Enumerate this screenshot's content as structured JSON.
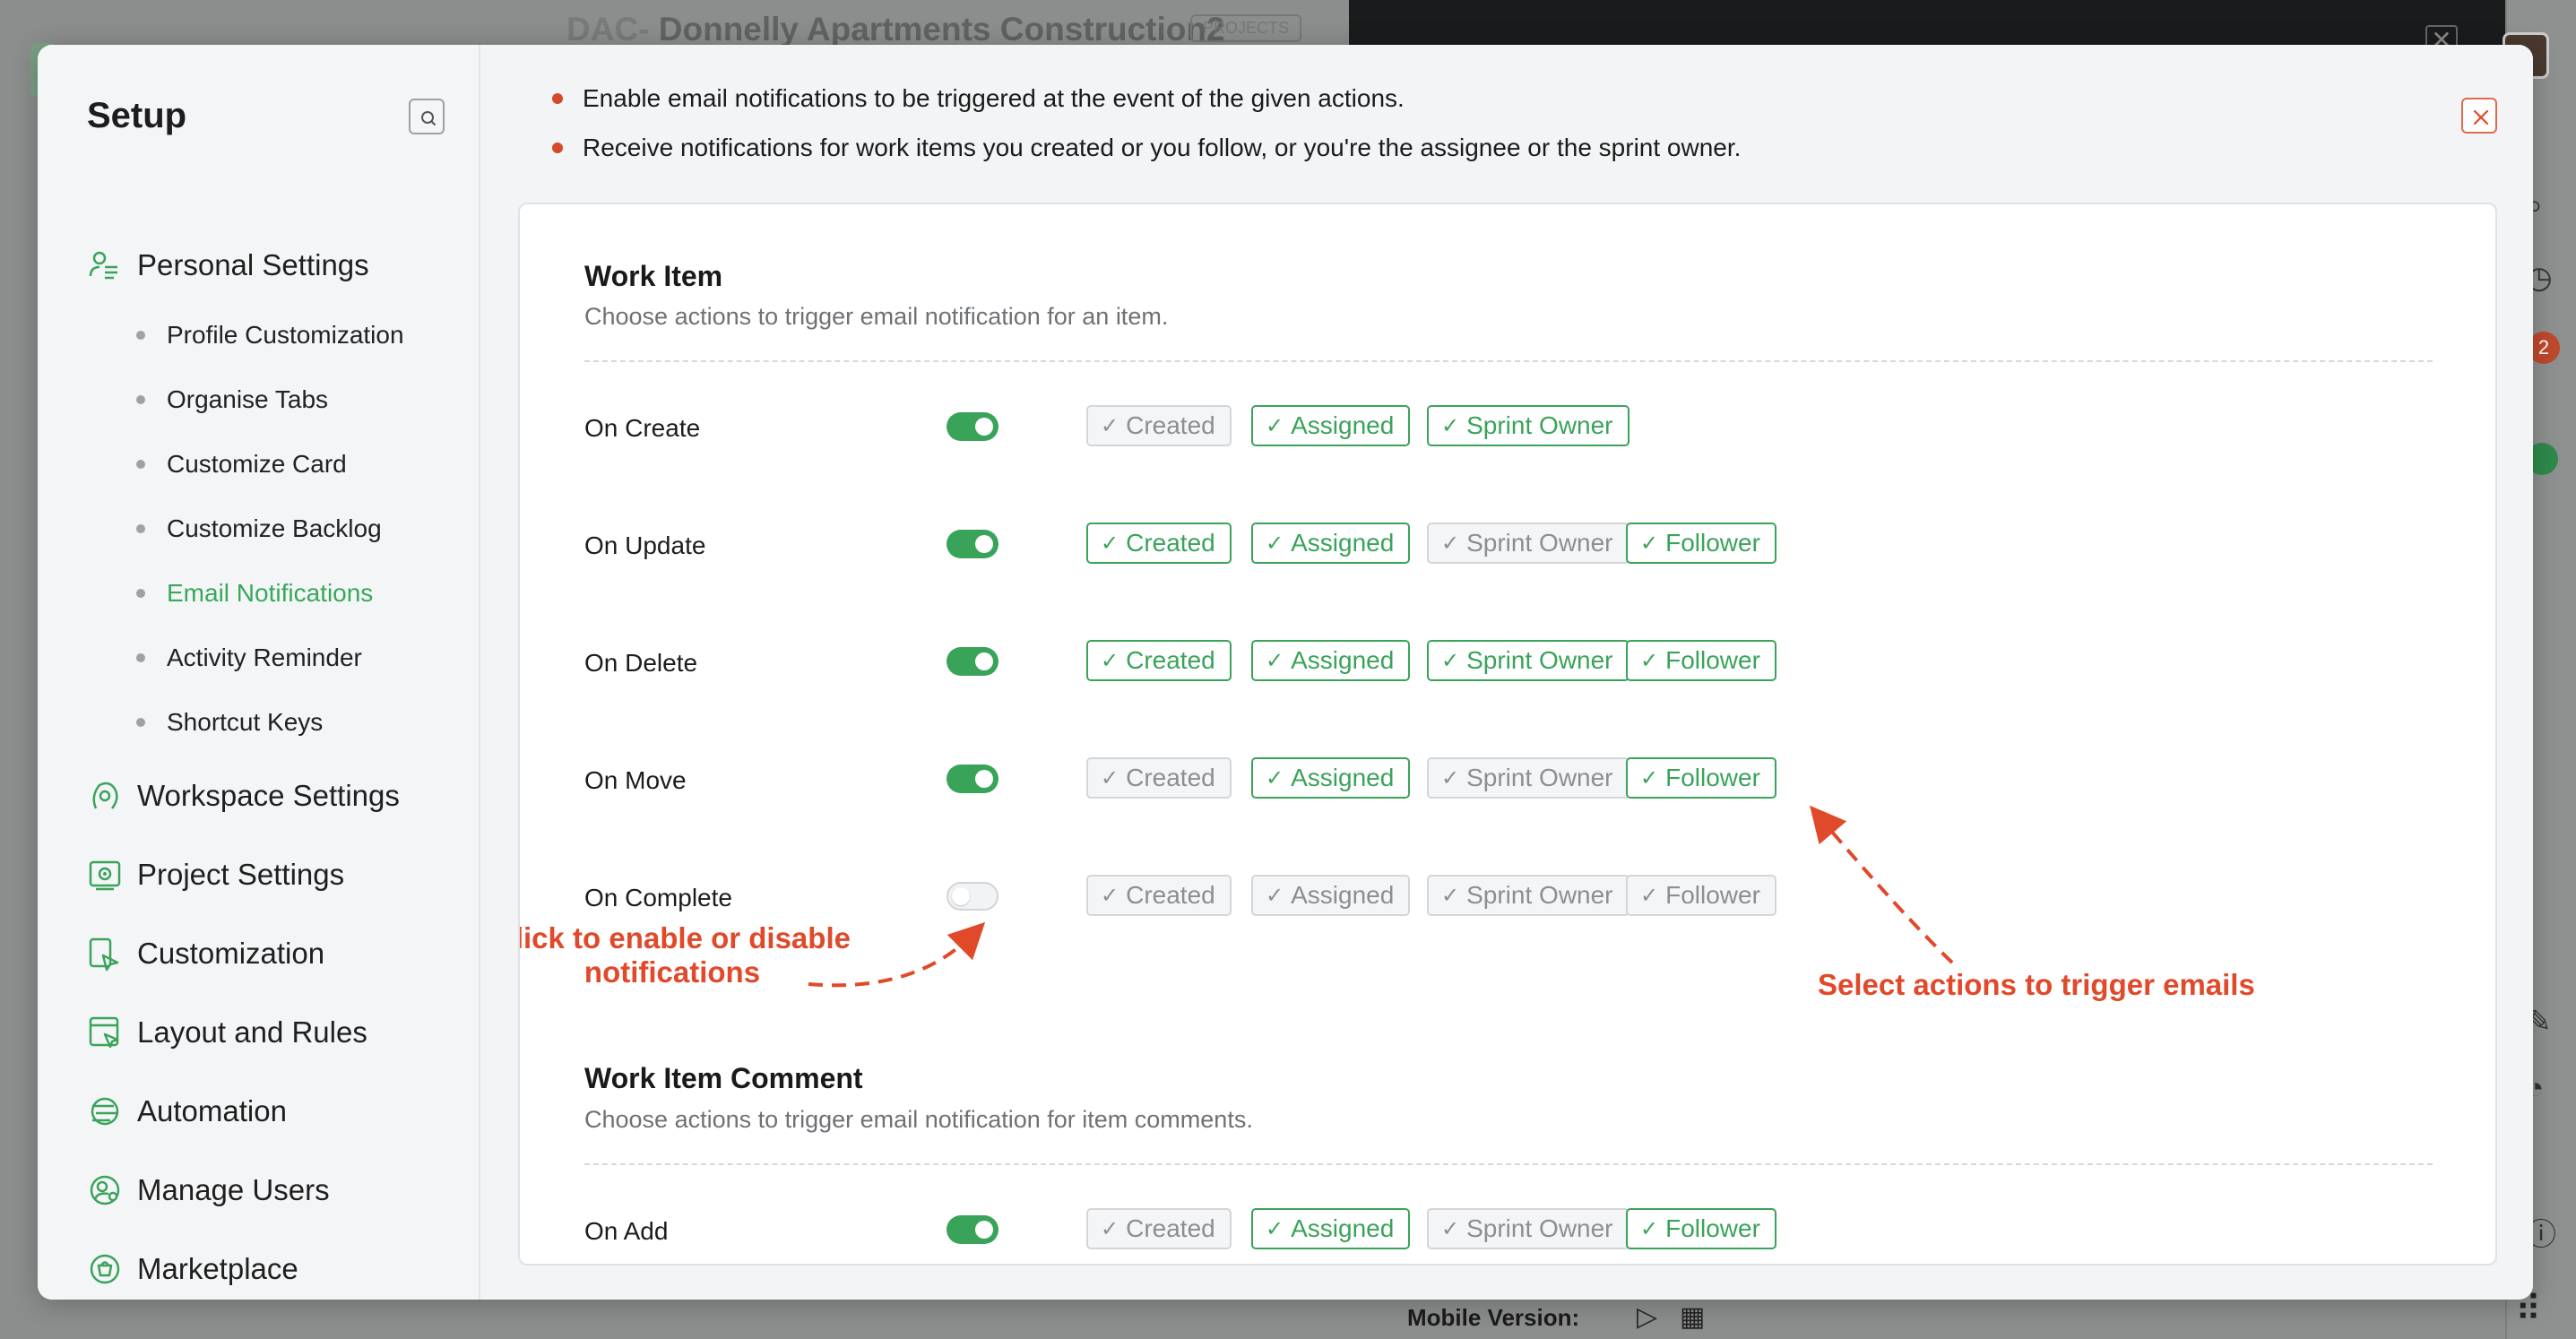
{
  "background": {
    "project_prefix": "DAC-",
    "project_title": "Donnelly Apartments Construction2",
    "project_badge": "PROJECTS",
    "close_glyph": "✕",
    "badge_count": "2",
    "mobile_version_label": "Mobile Version:"
  },
  "sidebar": {
    "title": "Setup",
    "search_icon": "search-icon",
    "sections": [
      {
        "label": "Personal Settings",
        "icon": "personal-settings-icon"
      },
      {
        "label": "Workspace Settings",
        "icon": "workspace-settings-icon"
      },
      {
        "label": "Project Settings",
        "icon": "project-settings-icon"
      },
      {
        "label": "Customization",
        "icon": "customization-icon"
      },
      {
        "label": "Layout and Rules",
        "icon": "layout-rules-icon"
      },
      {
        "label": "Automation",
        "icon": "automation-icon"
      },
      {
        "label": "Manage Users",
        "icon": "manage-users-icon"
      },
      {
        "label": "Marketplace",
        "icon": "marketplace-icon"
      }
    ],
    "personal_items": [
      {
        "label": "Profile Customization",
        "active": false
      },
      {
        "label": "Organise Tabs",
        "active": false
      },
      {
        "label": "Customize Card",
        "active": false
      },
      {
        "label": "Customize Backlog",
        "active": false
      },
      {
        "label": "Email Notifications",
        "active": true
      },
      {
        "label": "Activity Reminder",
        "active": false
      },
      {
        "label": "Shortcut Keys",
        "active": false
      }
    ]
  },
  "main": {
    "info": [
      "Enable email notifications to be triggered at the event of the given actions.",
      "Receive notifications for work items you created or you follow, or you're the assignee or the sprint owner."
    ],
    "work_item": {
      "title": "Work Item",
      "description": "Choose actions to trigger email notification for an item.",
      "rows": [
        {
          "label": "On Create",
          "enabled": true,
          "chips": [
            {
              "label": "Created",
              "on": false
            },
            {
              "label": "Assigned",
              "on": true
            },
            {
              "label": "Sprint Owner",
              "on": true
            }
          ]
        },
        {
          "label": "On Update",
          "enabled": true,
          "chips": [
            {
              "label": "Created",
              "on": true
            },
            {
              "label": "Assigned",
              "on": true
            },
            {
              "label": "Sprint Owner",
              "on": false
            },
            {
              "label": "Follower",
              "on": true
            }
          ]
        },
        {
          "label": "On Delete",
          "enabled": true,
          "chips": [
            {
              "label": "Created",
              "on": true
            },
            {
              "label": "Assigned",
              "on": true
            },
            {
              "label": "Sprint Owner",
              "on": true
            },
            {
              "label": "Follower",
              "on": true
            }
          ]
        },
        {
          "label": "On Move",
          "enabled": true,
          "chips": [
            {
              "label": "Created",
              "on": false
            },
            {
              "label": "Assigned",
              "on": true
            },
            {
              "label": "Sprint Owner",
              "on": false
            },
            {
              "label": "Follower",
              "on": true
            }
          ]
        },
        {
          "label": "On Complete",
          "enabled": false,
          "chips": [
            {
              "label": "Created",
              "on": false
            },
            {
              "label": "Assigned",
              "on": false
            },
            {
              "label": "Sprint Owner",
              "on": false
            },
            {
              "label": "Follower",
              "on": false
            }
          ]
        }
      ]
    },
    "work_item_comment": {
      "title": "Work Item Comment",
      "description": "Choose actions to trigger email notification for item comments.",
      "rows": [
        {
          "label": "On Add",
          "enabled": true,
          "chips": [
            {
              "label": "Created",
              "on": false
            },
            {
              "label": "Assigned",
              "on": true
            },
            {
              "label": "Sprint Owner",
              "on": false
            },
            {
              "label": "Follower",
              "on": true
            }
          ]
        }
      ]
    },
    "annotations": {
      "toggle_hint_line1": "Click to enable or disable",
      "toggle_hint_line2": "notifications",
      "chips_hint": "Select actions to trigger emails"
    },
    "check_glyph": "✓"
  },
  "colors": {
    "accent_green": "#3aa35a",
    "annotation_red": "#e0492a",
    "inactive_gray": "#8b8e92"
  }
}
